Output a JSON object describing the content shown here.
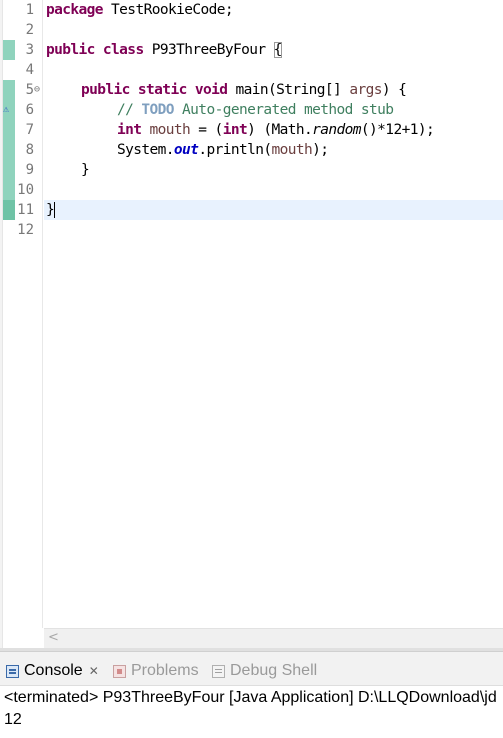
{
  "editor": {
    "line_numbers": [
      "1",
      "2",
      "3",
      "4",
      "5",
      "6",
      "7",
      "8",
      "9",
      "10",
      "11",
      "12"
    ],
    "lines": {
      "l1": {
        "kw": "package",
        "rest": " TestRookieCode;"
      },
      "l3": {
        "kw1": "public",
        "kw2": "class",
        "name": " P93ThreeByFour ",
        "brace": "{"
      },
      "l5": {
        "kw1": "public",
        "kw2": "static",
        "kw3": "void",
        "sig": " main(String[] ",
        "param": "args",
        "end": ") {"
      },
      "l6": {
        "comment_start": "// ",
        "todo": "TODO",
        "comment_rest": " Auto-generated method stub"
      },
      "l7": {
        "kw": "int",
        "var": " mouth",
        "mid": " = (",
        "cast": "int",
        "call": ") (Math.",
        "method": "random",
        "end": "()*12+1);"
      },
      "l8": {
        "pre": "System.",
        "field": "out",
        "mid": ".println(",
        "var": "mouth",
        "end": ");"
      },
      "l9": {
        "text": "}"
      },
      "l11": {
        "text": "}"
      }
    },
    "fold_marker": "⊖",
    "warning_marker": "⚠",
    "scroll_left_icon": "<"
  },
  "console": {
    "tabs": [
      {
        "label": "Console",
        "icon": "console-icon",
        "close": "✕"
      },
      {
        "label": "Problems",
        "icon": "problems-icon"
      },
      {
        "label": "Debug Shell",
        "icon": "debug-icon"
      }
    ],
    "status": "<terminated> P93ThreeByFour [Java Application] D:\\LLQDownload\\jd",
    "output": "12"
  }
}
